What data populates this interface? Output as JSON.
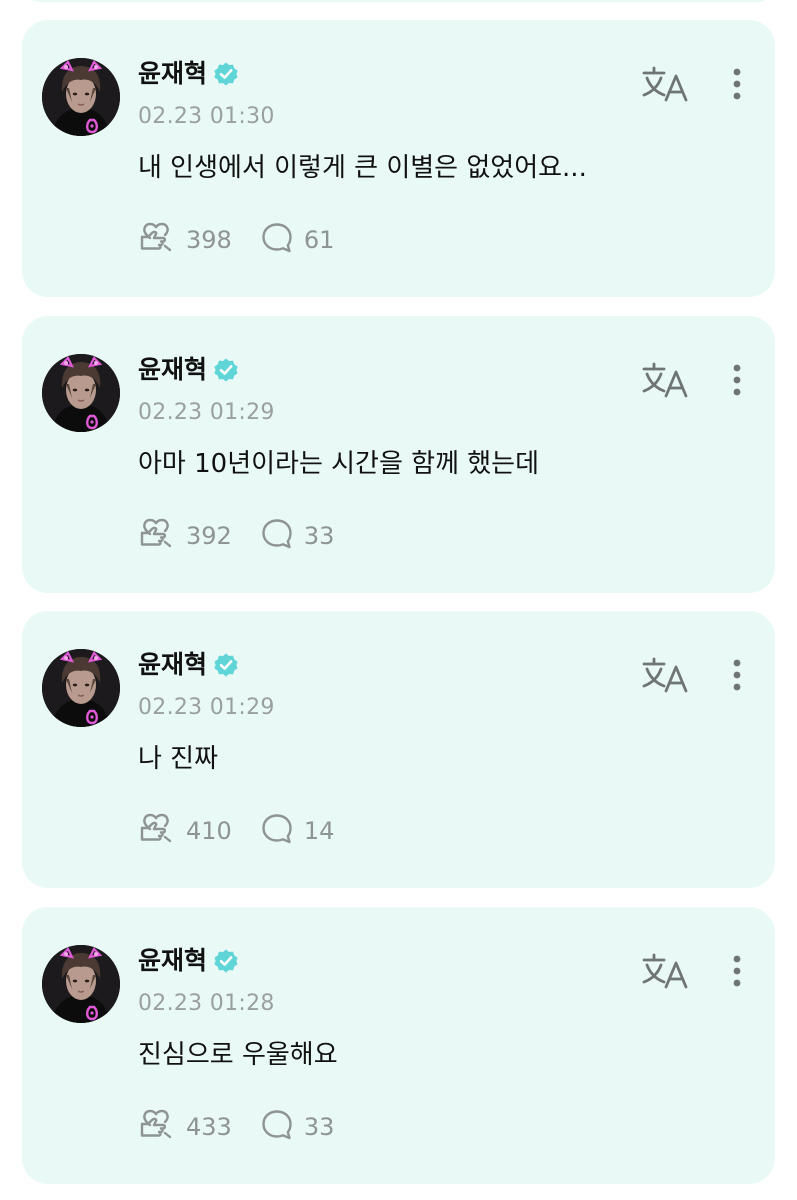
{
  "posts": [
    {
      "author": "윤재혁",
      "timestamp": "02.23 01:30",
      "message": "내 인생에서 이렇게 큰 이별은 없었어요...",
      "likes": "398",
      "comments": "61"
    },
    {
      "author": "윤재혁",
      "timestamp": "02.23 01:29",
      "message": "아마 10년이라는 시간을 함께 했는데",
      "likes": "392",
      "comments": "33"
    },
    {
      "author": "윤재혁",
      "timestamp": "02.23 01:29",
      "message": "나 진짜",
      "likes": "410",
      "comments": "14"
    },
    {
      "author": "윤재혁",
      "timestamp": "02.23 01:28",
      "message": "진심으로 우울해요",
      "likes": "433",
      "comments": "33"
    }
  ],
  "icons": {
    "verified": "verified-badge-icon",
    "like": "heart-hand-icon",
    "comment": "speech-bubble-icon",
    "translate": "translate-icon",
    "more": "more-vertical-icon"
  },
  "colors": {
    "card_background": "#e9f9f6",
    "verified_badge": "#5fd5d8",
    "muted_text": "#9a9fa1"
  }
}
